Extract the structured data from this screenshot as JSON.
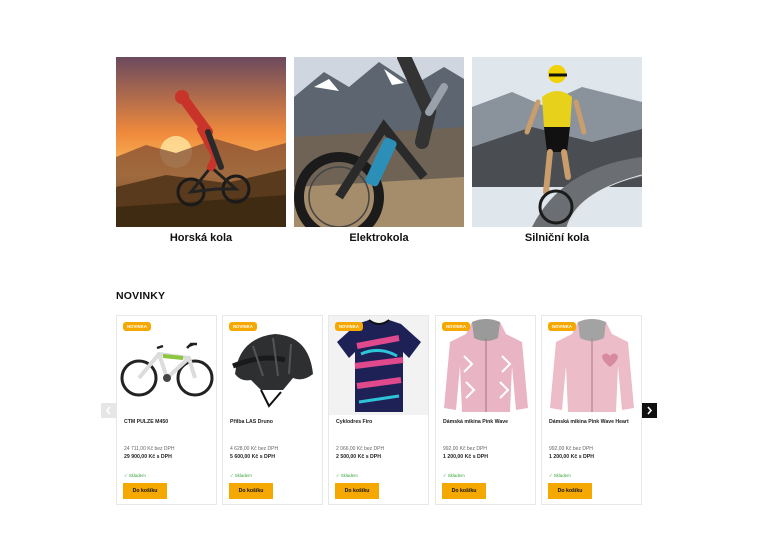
{
  "categories": [
    {
      "label": "Horská kola",
      "image": "mountain-bike-sunset-photo"
    },
    {
      "label": "Elektrokola",
      "image": "electric-bike-mountains-photo"
    },
    {
      "label": "Silniční kola",
      "image": "road-bike-cyclist-photo"
    }
  ],
  "section_title": "NOVINKY",
  "products": [
    {
      "badge": "NOVINKA",
      "name": "CTM PULZE M450",
      "price_net": "24 711,00 Kč bez DPH",
      "price_gross": "29 900,00 Kč s DPH",
      "stock": "Skladem",
      "button": "Do košíku",
      "image": "e-bike-product"
    },
    {
      "badge": "NOVINKA",
      "name": "Přilba LAS Druno",
      "price_net": "4 628,00 Kč bez DPH",
      "price_gross": "5 600,00 Kč s DPH",
      "stock": "Skladem",
      "button": "Do košíku",
      "image": "helmet-product"
    },
    {
      "badge": "NOVINKA",
      "name": "Cyklodres Firo",
      "price_net": "2 066,00 Kč bez DPH",
      "price_gross": "2 500,00 Kč s DPH",
      "stock": "Skladem",
      "button": "Do košíku",
      "image": "cycling-jersey-product"
    },
    {
      "badge": "NOVINKA",
      "name": "Dámská mikina Pink Wave",
      "price_net": "992,00 Kč bez DPH",
      "price_gross": "1 200,00 Kč s DPH",
      "stock": "Skladem",
      "button": "Do košíku",
      "image": "pink-hoodie-product"
    },
    {
      "badge": "NOVINKA",
      "name": "Dámská mikina Pink Wave Heart",
      "price_net": "992,00 Kč bez DPH",
      "price_gross": "1 200,00 Kč s DPH",
      "stock": "Skladem",
      "button": "Do košíku",
      "image": "pink-hoodie-heart-product"
    }
  ],
  "carousel": {
    "prev_icon": "chevron-left-icon",
    "next_icon": "chevron-right-icon"
  },
  "colors": {
    "accent": "#f5a800",
    "stock_green": "#3aa53a",
    "text": "#111111"
  }
}
